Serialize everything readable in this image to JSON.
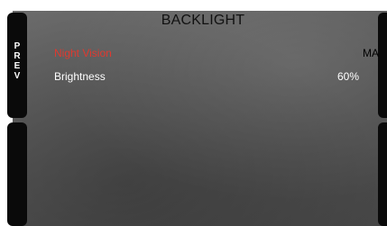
{
  "screen": {
    "title": "BACKLIGHT",
    "prev_key": [
      "P",
      "R",
      "E",
      "V"
    ]
  },
  "menu": {
    "items": [
      {
        "label": "Night Vision",
        "value": "MA",
        "selected": true
      },
      {
        "label": "Brightness",
        "value": "60%",
        "selected": false
      }
    ]
  },
  "colors": {
    "selected_text": "#e0392f",
    "normal_text": "#ffffff",
    "softkey": "#0a0a0a",
    "background": "#5a5a5a"
  }
}
